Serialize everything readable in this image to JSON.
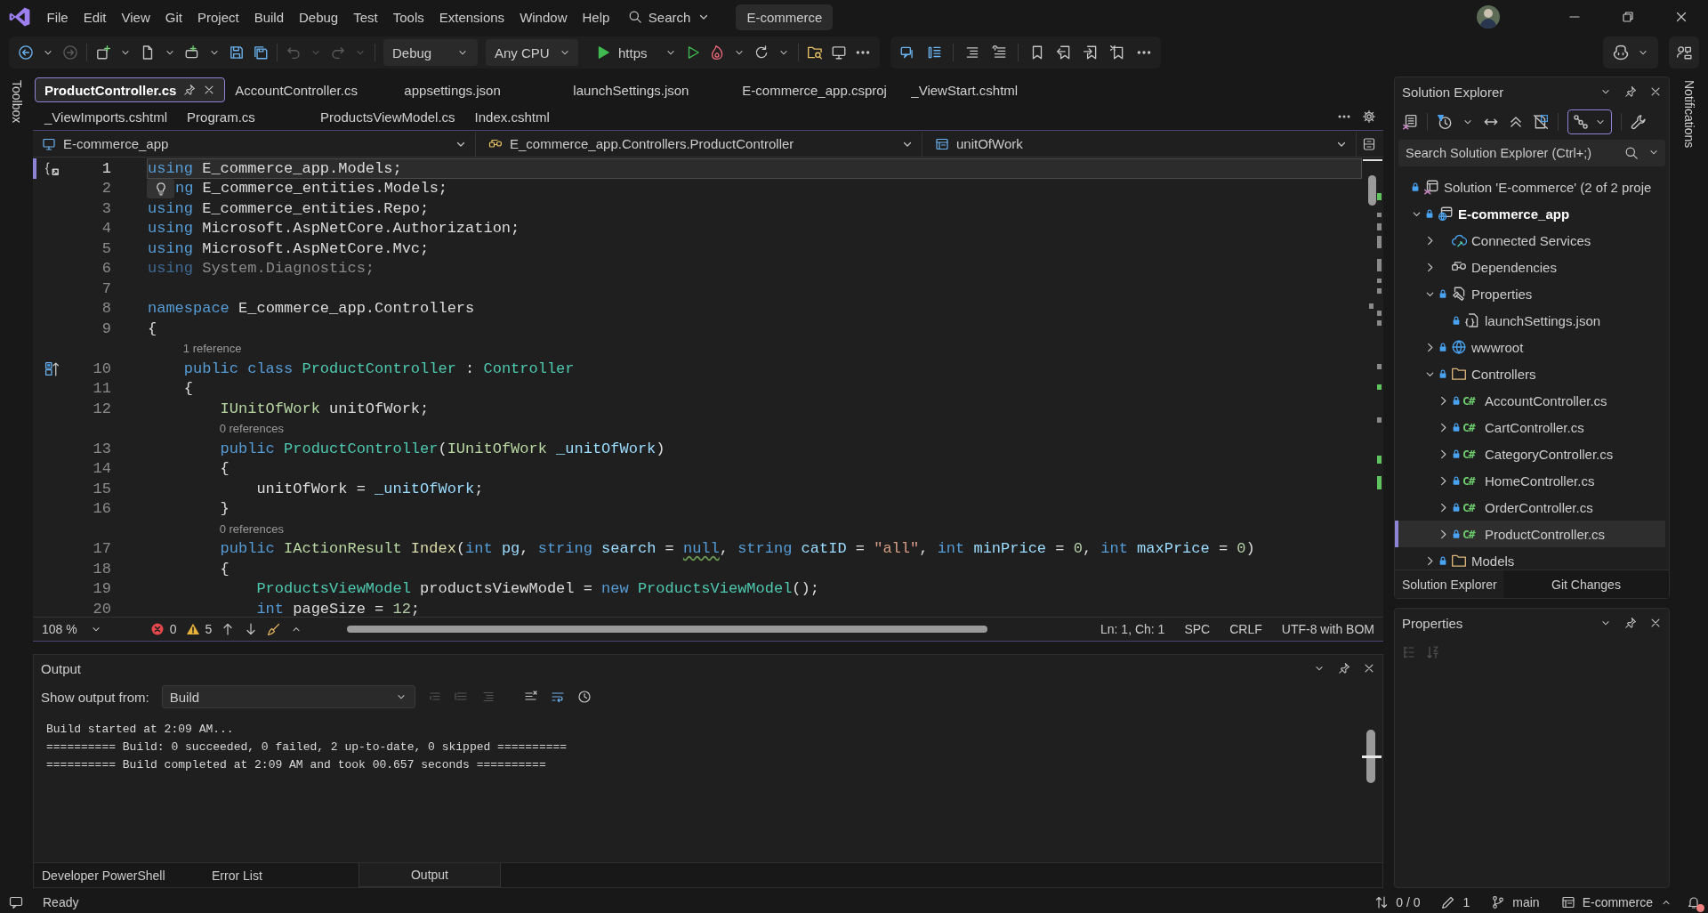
{
  "menu_bar": {
    "items": [
      "File",
      "Edit",
      "View",
      "Git",
      "Project",
      "Build",
      "Debug",
      "Test",
      "Tools",
      "Extensions",
      "Window",
      "Help"
    ],
    "search_label": "Search",
    "solution_name": "E-commerce"
  },
  "toolbar": {
    "configuration": "Debug",
    "platform": "Any CPU",
    "launch_profile": "https"
  },
  "side_strips": {
    "left": "Toolbox",
    "right": "Notifications"
  },
  "tab_rows": [
    {
      "tabs": [
        {
          "label": "ProductController.cs",
          "selected": true
        },
        {
          "label": "AccountController.cs",
          "selected": false
        },
        {
          "label": "appsettings.json",
          "selected": false
        },
        {
          "label": "launchSettings.json",
          "selected": false
        },
        {
          "label": "E-commerce_app.csproj",
          "selected": false
        },
        {
          "label": "_ViewStart.cshtml",
          "selected": false
        }
      ]
    },
    {
      "tabs": [
        {
          "label": "_ViewImports.cshtml",
          "selected": false
        },
        {
          "label": "Program.cs",
          "selected": false
        },
        {
          "label": "ProductsViewModel.cs",
          "selected": false
        },
        {
          "label": "Index.cshtml",
          "selected": false
        }
      ]
    }
  ],
  "navigation_bar": {
    "project": "E-commerce_app",
    "type": "E_commerce_app.Controllers.ProductController",
    "member": "unitOfWork"
  },
  "code_lines": [
    {
      "kind": "code",
      "number": "1",
      "current": true,
      "margin_icon": {
        "kind": "braces"
      },
      "tokens": [
        {
          "kind": "keyword",
          "text": "using"
        },
        {
          "kind": "plain",
          "text": " E_commerce_app.Models;"
        }
      ]
    },
    {
      "kind": "code",
      "number": "2",
      "current": false,
      "lightbulb": true,
      "tokens": [
        {
          "kind": "keyword",
          "text": "ng"
        },
        {
          "kind": "plain",
          "text": " E_commerce_entities.Models;"
        }
      ]
    },
    {
      "kind": "code",
      "number": "3",
      "current": false,
      "tokens": [
        {
          "kind": "keyword",
          "text": "using"
        },
        {
          "kind": "plain",
          "text": " E_commerce_entities.Repo;"
        }
      ]
    },
    {
      "kind": "code",
      "number": "4",
      "current": false,
      "tokens": [
        {
          "kind": "keyword",
          "text": "using"
        },
        {
          "kind": "plain",
          "text": " Microsoft.AspNetCore.Authorization;"
        }
      ]
    },
    {
      "kind": "code",
      "number": "5",
      "current": false,
      "tokens": [
        {
          "kind": "keyword",
          "text": "using"
        },
        {
          "kind": "plain",
          "text": " Microsoft.AspNetCore.Mvc;"
        }
      ]
    },
    {
      "kind": "code",
      "number": "6",
      "current": false,
      "tokens": [
        {
          "kind": "faded-keyword",
          "text": "using"
        },
        {
          "kind": "faded",
          "text": " System.Diagnostics;"
        }
      ]
    },
    {
      "kind": "code",
      "number": "7",
      "current": false
    },
    {
      "kind": "code",
      "number": "8",
      "current": false,
      "tokens": [
        {
          "kind": "keyword",
          "text": "namespace"
        },
        {
          "kind": "plain",
          "text": " E_commerce_app.Controllers"
        }
      ]
    },
    {
      "kind": "code",
      "number": "9",
      "current": false,
      "tokens": [
        {
          "kind": "plain",
          "text": "{"
        }
      ]
    },
    {
      "kind": "codelens",
      "text": "1 reference"
    },
    {
      "kind": "code",
      "number": "10",
      "current": false,
      "margin_icon": {
        "kind": "inheritance"
      },
      "tokens": [
        {
          "kind": "keyword",
          "text": "    public class "
        },
        {
          "kind": "type",
          "text": "ProductController"
        },
        {
          "kind": "plain",
          "text": " : "
        },
        {
          "kind": "type",
          "text": "Controller"
        }
      ]
    },
    {
      "kind": "code",
      "number": "11",
      "current": false,
      "tokens": [
        {
          "kind": "plain",
          "text": "    {"
        }
      ]
    },
    {
      "kind": "code",
      "number": "12",
      "current": false,
      "tokens": [
        {
          "kind": "interface",
          "text": "        IUnitOfWork"
        },
        {
          "kind": "plain",
          "text": " unitOfWork;"
        }
      ]
    },
    {
      "kind": "codelens",
      "text": "0 references"
    },
    {
      "kind": "code",
      "number": "13",
      "current": false,
      "tokens": [
        {
          "kind": "keyword",
          "text": "        public "
        },
        {
          "kind": "type",
          "text": "ProductController"
        },
        {
          "kind": "plain",
          "text": "("
        },
        {
          "kind": "interface",
          "text": "IUnitOfWork"
        },
        {
          "kind": "parameter",
          "text": " _unitOfWork"
        },
        {
          "kind": "plain",
          "text": ")"
        }
      ]
    },
    {
      "kind": "code",
      "number": "14",
      "current": false,
      "tokens": [
        {
          "kind": "plain",
          "text": "        {"
        }
      ]
    },
    {
      "kind": "code",
      "number": "15",
      "current": false,
      "tokens": [
        {
          "kind": "plain",
          "text": "            unitOfWork = "
        },
        {
          "kind": "parameter",
          "text": "_unitOfWork"
        },
        {
          "kind": "plain",
          "text": ";"
        }
      ]
    },
    {
      "kind": "code",
      "number": "16",
      "current": false,
      "tokens": [
        {
          "kind": "plain",
          "text": "        }"
        }
      ]
    },
    {
      "kind": "codelens",
      "text": "0 references"
    },
    {
      "kind": "code",
      "number": "17",
      "current": false,
      "tokens": [
        {
          "kind": "keyword",
          "text": "        public "
        },
        {
          "kind": "interface",
          "text": "IActionResult "
        },
        {
          "kind": "method",
          "text": "Index"
        },
        {
          "kind": "plain",
          "text": "("
        },
        {
          "kind": "keyword",
          "text": "int"
        },
        {
          "kind": "parameter",
          "text": " pg"
        },
        {
          "kind": "plain",
          "text": ", "
        },
        {
          "kind": "keyword",
          "text": "string"
        },
        {
          "kind": "parameter",
          "text": " search"
        },
        {
          "kind": "plain",
          "text": " = "
        },
        {
          "kind": "keyword",
          "text": "null",
          "squiggle": true
        },
        {
          "kind": "plain",
          "text": ", "
        },
        {
          "kind": "keyword",
          "text": "string"
        },
        {
          "kind": "parameter",
          "text": " catID"
        },
        {
          "kind": "plain",
          "text": " = "
        },
        {
          "kind": "string",
          "text": "\"all\""
        },
        {
          "kind": "plain",
          "text": ", "
        },
        {
          "kind": "keyword",
          "text": "int"
        },
        {
          "kind": "parameter",
          "text": " minPrice"
        },
        {
          "kind": "plain",
          "text": " = "
        },
        {
          "kind": "number",
          "text": "0"
        },
        {
          "kind": "plain",
          "text": ", "
        },
        {
          "kind": "keyword",
          "text": "int"
        },
        {
          "kind": "parameter",
          "text": " maxPrice"
        },
        {
          "kind": "plain",
          "text": " = "
        },
        {
          "kind": "number",
          "text": "0"
        },
        {
          "kind": "plain",
          "text": ")"
        }
      ]
    },
    {
      "kind": "code",
      "number": "18",
      "current": false,
      "tokens": [
        {
          "kind": "plain",
          "text": "        {"
        }
      ]
    },
    {
      "kind": "code",
      "number": "19",
      "current": false,
      "tokens": [
        {
          "kind": "type",
          "text": "            ProductsViewModel"
        },
        {
          "kind": "plain",
          "text": " productsViewModel = "
        },
        {
          "kind": "keyword",
          "text": "new "
        },
        {
          "kind": "type",
          "text": "ProductsViewModel"
        },
        {
          "kind": "plain",
          "text": "();"
        }
      ]
    },
    {
      "kind": "code",
      "number": "20",
      "current": false,
      "tokens": [
        {
          "kind": "keyword",
          "text": "            int"
        },
        {
          "kind": "plain",
          "text": " pageSize = "
        },
        {
          "kind": "number",
          "text": "12"
        },
        {
          "kind": "plain",
          "text": ";"
        }
      ]
    }
  ],
  "editor_status": {
    "zoom": "108 %",
    "errors": "0",
    "warnings": "5",
    "position": "Ln: 1, Ch: 1",
    "whitespace": "SPC",
    "line_endings": "CRLF",
    "encoding": "UTF-8 with BOM"
  },
  "output": {
    "title": "Output",
    "source_label": "Show output from:",
    "source": "Build",
    "lines": [
      "Build started at 2:09 AM...",
      "========== Build: 0 succeeded, 0 failed, 2 up-to-date, 0 skipped ==========",
      "========== Build completed at 2:09 AM and took 00.657 seconds =========="
    ]
  },
  "bottom_tabs": [
    {
      "label": "Developer PowerShell",
      "selected": false
    },
    {
      "label": "Error List",
      "selected": false
    },
    {
      "label": "Output",
      "selected": true
    }
  ],
  "solution_explorer": {
    "title": "Solution Explorer",
    "search": {
      "placeholder": "Search Solution Explorer (Ctrl+;)"
    },
    "tree": [
      {
        "label": "Solution 'E-commerce' (2 of 2 proje",
        "kind": "solution",
        "locked": true,
        "selected": false,
        "children": [
          {
            "label": "E-commerce_app",
            "kind": "project",
            "locked": true,
            "expander": {
              "kind": "open"
            },
            "selected": false,
            "children": [
              {
                "label": "Connected Services",
                "kind": "connected-services",
                "locked": false,
                "expander": {
                  "kind": "closed"
                },
                "selected": false
              },
              {
                "label": "Dependencies",
                "kind": "dependencies",
                "locked": false,
                "expander": {
                  "kind": "closed"
                },
                "selected": false
              },
              {
                "label": "Properties",
                "kind": "properties",
                "locked": true,
                "expander": {
                  "kind": "open"
                },
                "selected": false,
                "children": [
                  {
                    "label": "launchSettings.json",
                    "kind": "json",
                    "locked": true,
                    "selected": false
                  }
                ]
              },
              {
                "label": "wwwroot",
                "kind": "web-root",
                "locked": true,
                "expander": {
                  "kind": "closed"
                },
                "selected": false
              },
              {
                "label": "Controllers",
                "kind": "folder",
                "locked": true,
                "expander": {
                  "kind": "open"
                },
                "selected": false,
                "children": [
                  {
                    "label": "AccountController.cs",
                    "kind": "csharp",
                    "type_label": "C#",
                    "locked": true,
                    "expander": {
                      "kind": "closed"
                    },
                    "selected": false
                  },
                  {
                    "label": "CartController.cs",
                    "kind": "csharp",
                    "type_label": "C#",
                    "locked": true,
                    "expander": {
                      "kind": "closed"
                    },
                    "selected": false
                  },
                  {
                    "label": "CategoryController.cs",
                    "kind": "csharp",
                    "type_label": "C#",
                    "locked": true,
                    "expander": {
                      "kind": "closed"
                    },
                    "selected": false
                  },
                  {
                    "label": "HomeController.cs",
                    "kind": "csharp",
                    "type_label": "C#",
                    "locked": true,
                    "expander": {
                      "kind": "closed"
                    },
                    "selected": false
                  },
                  {
                    "label": "OrderController.cs",
                    "kind": "csharp",
                    "type_label": "C#",
                    "locked": true,
                    "expander": {
                      "kind": "closed"
                    },
                    "selected": false
                  },
                  {
                    "label": "ProductController.cs",
                    "kind": "csharp",
                    "type_label": "C#",
                    "locked": true,
                    "expander": {
                      "kind": "closed"
                    },
                    "selected": true
                  }
                ]
              },
              {
                "label": "Models",
                "kind": "folder",
                "locked": true,
                "expander": {
                  "kind": "closed"
                },
                "selected": false
              }
            ]
          }
        ]
      }
    ],
    "tabs": [
      {
        "label": "Solution Explorer",
        "selected": true
      },
      {
        "label": "Git Changes",
        "selected": false
      }
    ]
  },
  "properties": {
    "title": "Properties"
  },
  "status_bar": {
    "state": "Ready",
    "sync": "0 / 0",
    "pending_changes": "1",
    "branch": "main",
    "repository": "E-commerce"
  }
}
